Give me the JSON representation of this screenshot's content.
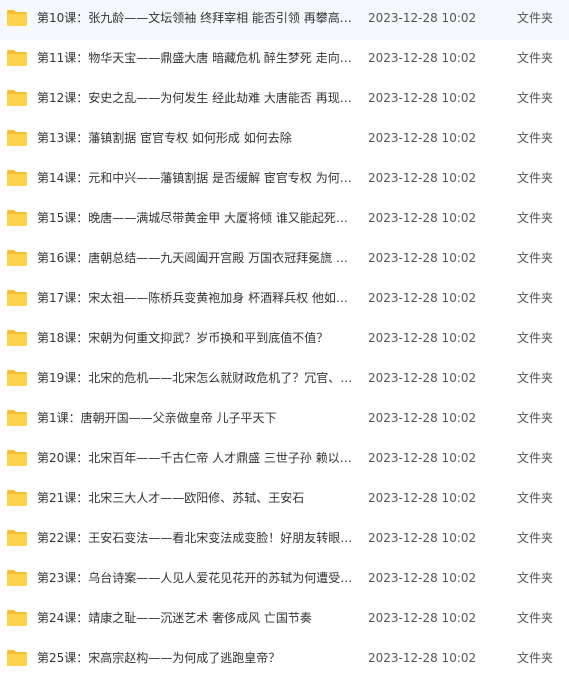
{
  "colors": {
    "folder_body": "#FFD24D",
    "folder_tab": "#F6BE2C",
    "text": "#333333"
  },
  "files": [
    {
      "name": "第10课：张九龄——文坛领袖 终拜宰相 能否引领 再攀高…",
      "date": "2023-12-28 10:02",
      "type": "文件夹",
      "icon": "folder-icon"
    },
    {
      "name": "第11课：物华天宝——鼎盛大唐 暗藏危机 醉生梦死 走向…",
      "date": "2023-12-28 10:02",
      "type": "文件夹",
      "icon": "folder-icon"
    },
    {
      "name": "第12课：安史之乱——为何发生 经此劫难 大唐能否 再现…",
      "date": "2023-12-28 10:02",
      "type": "文件夹",
      "icon": "folder-icon"
    },
    {
      "name": "第13课：藩镇割据 宦官专权 如何形成 如何去除",
      "date": "2023-12-28 10:02",
      "type": "文件夹",
      "icon": "folder-icon"
    },
    {
      "name": "第14课：元和中兴——藩镇割据 是否缓解 宦官专权 为何…",
      "date": "2023-12-28 10:02",
      "type": "文件夹",
      "icon": "folder-icon"
    },
    {
      "name": "第15课：晚唐——满城尽带黄金甲 大厦将倾 谁又能起死…",
      "date": "2023-12-28 10:02",
      "type": "文件夹",
      "icon": "folder-icon"
    },
    {
      "name": "第16课：唐朝总结——九天阊阖开宫殿 万国衣冠拜冕旒 …",
      "date": "2023-12-28 10:02",
      "type": "文件夹",
      "icon": "folder-icon"
    },
    {
      "name": "第17课：宋太祖——陈桥兵变黄袍加身 杯酒释兵权 他如…",
      "date": "2023-12-28 10:02",
      "type": "文件夹",
      "icon": "folder-icon"
    },
    {
      "name": "第18课：宋朝为何重文抑武？岁币换和平到底值不值？",
      "date": "2023-12-28 10:02",
      "type": "文件夹",
      "icon": "folder-icon"
    },
    {
      "name": "第19课：北宋的危机——北宋怎么就财政危机了？冗官、…",
      "date": "2023-12-28 10:02",
      "type": "文件夹",
      "icon": "folder-icon"
    },
    {
      "name": "第1课：唐朝开国——父亲做皇帝 儿子平天下",
      "date": "2023-12-28 10:02",
      "type": "文件夹",
      "icon": "folder-icon"
    },
    {
      "name": "第20课：北宋百年——千古仁帝 人才鼎盛 三世子孙 赖以…",
      "date": "2023-12-28 10:02",
      "type": "文件夹",
      "icon": "folder-icon"
    },
    {
      "name": "第21课：北宋三大人才——欧阳修、苏轼、王安石",
      "date": "2023-12-28 10:02",
      "type": "文件夹",
      "icon": "folder-icon"
    },
    {
      "name": "第22课：王安石变法——看北宋变法成变脸！好朋友转眼…",
      "date": "2023-12-28 10:02",
      "type": "文件夹",
      "icon": "folder-icon"
    },
    {
      "name": "第23课：乌台诗案——人见人爱花见花开的苏轼为何遭受…",
      "date": "2023-12-28 10:02",
      "type": "文件夹",
      "icon": "folder-icon"
    },
    {
      "name": "第24课：靖康之耻——沉迷艺术 奢侈成风 亡国节奏",
      "date": "2023-12-28 10:02",
      "type": "文件夹",
      "icon": "folder-icon"
    },
    {
      "name": "第25课：宋高宗赵构——为何成了逃跑皇帝？",
      "date": "2023-12-28 10:02",
      "type": "文件夹",
      "icon": "folder-icon"
    }
  ]
}
